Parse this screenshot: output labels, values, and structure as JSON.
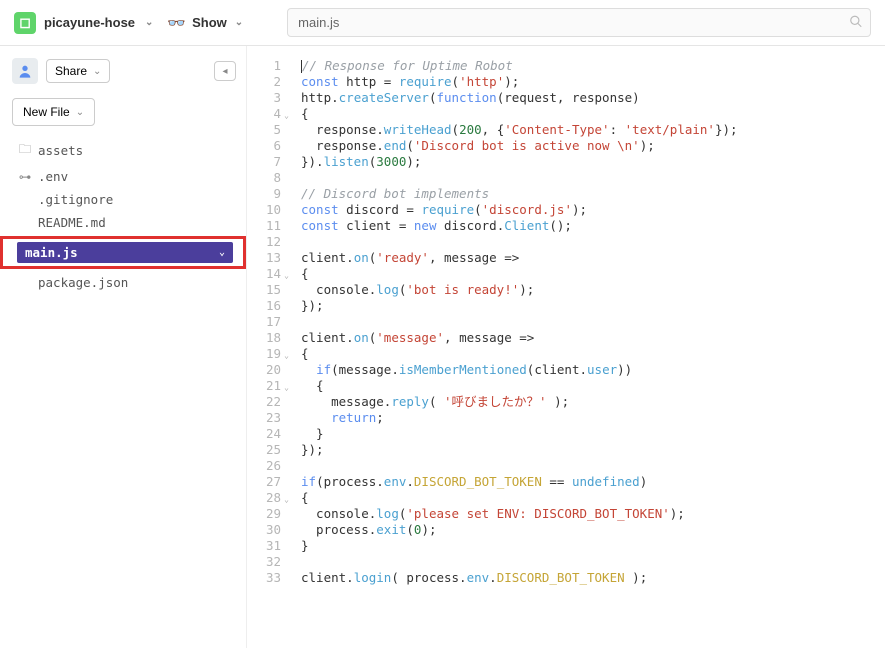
{
  "header": {
    "project_name": "picayune-hose",
    "show_label": "Show",
    "search_value": "main.js"
  },
  "sidebar": {
    "share_label": "Share",
    "newfile_label": "New File",
    "files": [
      {
        "icon": "folder",
        "name": "assets"
      },
      {
        "icon": "key",
        "name": ".env"
      },
      {
        "icon": "",
        "name": ".gitignore"
      },
      {
        "icon": "",
        "name": "README.md"
      },
      {
        "icon": "",
        "name": "main.js",
        "active": true
      },
      {
        "icon": "",
        "name": "package.json"
      }
    ]
  },
  "colors": {
    "accent": "#5fd46a",
    "highlight_bg": "#4b3e9c",
    "highlight_border": "#e0312f"
  },
  "code": {
    "lines": [
      {
        "n": 1,
        "tokens": [
          {
            "t": "// Response for Uptime Robot",
            "c": "c-com",
            "cursor": true
          }
        ]
      },
      {
        "n": 2,
        "tokens": [
          {
            "t": "const",
            "c": "c-kw"
          },
          {
            "t": " http = "
          },
          {
            "t": "require",
            "c": "c-fn"
          },
          {
            "t": "("
          },
          {
            "t": "'http'",
            "c": "c-str"
          },
          {
            "t": ");"
          }
        ]
      },
      {
        "n": 3,
        "tokens": [
          {
            "t": "http."
          },
          {
            "t": "createServer",
            "c": "c-prop"
          },
          {
            "t": "("
          },
          {
            "t": "function",
            "c": "c-kw"
          },
          {
            "t": "(request, response)"
          }
        ]
      },
      {
        "n": 4,
        "fold": true,
        "tokens": [
          {
            "t": "{"
          }
        ]
      },
      {
        "n": 5,
        "tokens": [
          {
            "t": "  response."
          },
          {
            "t": "writeHead",
            "c": "c-prop"
          },
          {
            "t": "("
          },
          {
            "t": "200",
            "c": "c-num"
          },
          {
            "t": ", {"
          },
          {
            "t": "'Content-Type'",
            "c": "c-str"
          },
          {
            "t": ": "
          },
          {
            "t": "'text/plain'",
            "c": "c-str"
          },
          {
            "t": "});"
          }
        ]
      },
      {
        "n": 6,
        "tokens": [
          {
            "t": "  response."
          },
          {
            "t": "end",
            "c": "c-prop"
          },
          {
            "t": "("
          },
          {
            "t": "'Discord bot is active now \\n'",
            "c": "c-str"
          },
          {
            "t": ");"
          }
        ]
      },
      {
        "n": 7,
        "tokens": [
          {
            "t": "})."
          },
          {
            "t": "listen",
            "c": "c-prop"
          },
          {
            "t": "("
          },
          {
            "t": "3000",
            "c": "c-num"
          },
          {
            "t": ");"
          }
        ]
      },
      {
        "n": 8,
        "tokens": []
      },
      {
        "n": 9,
        "tokens": [
          {
            "t": "// Discord bot implements",
            "c": "c-com"
          }
        ]
      },
      {
        "n": 10,
        "tokens": [
          {
            "t": "const",
            "c": "c-kw"
          },
          {
            "t": " discord = "
          },
          {
            "t": "require",
            "c": "c-fn"
          },
          {
            "t": "("
          },
          {
            "t": "'discord.js'",
            "c": "c-str"
          },
          {
            "t": ");"
          }
        ]
      },
      {
        "n": 11,
        "tokens": [
          {
            "t": "const",
            "c": "c-kw"
          },
          {
            "t": " client = "
          },
          {
            "t": "new",
            "c": "c-kw"
          },
          {
            "t": " discord."
          },
          {
            "t": "Client",
            "c": "c-fn"
          },
          {
            "t": "();"
          }
        ]
      },
      {
        "n": 12,
        "tokens": []
      },
      {
        "n": 13,
        "tokens": [
          {
            "t": "client."
          },
          {
            "t": "on",
            "c": "c-prop"
          },
          {
            "t": "("
          },
          {
            "t": "'ready'",
            "c": "c-str"
          },
          {
            "t": ", message =>"
          }
        ]
      },
      {
        "n": 14,
        "fold": true,
        "tokens": [
          {
            "t": "{"
          }
        ]
      },
      {
        "n": 15,
        "tokens": [
          {
            "t": "  console."
          },
          {
            "t": "log",
            "c": "c-prop"
          },
          {
            "t": "("
          },
          {
            "t": "'bot is ready!'",
            "c": "c-str"
          },
          {
            "t": ");"
          }
        ]
      },
      {
        "n": 16,
        "tokens": [
          {
            "t": "});"
          }
        ]
      },
      {
        "n": 17,
        "tokens": []
      },
      {
        "n": 18,
        "tokens": [
          {
            "t": "client."
          },
          {
            "t": "on",
            "c": "c-prop"
          },
          {
            "t": "("
          },
          {
            "t": "'message'",
            "c": "c-str"
          },
          {
            "t": ", message =>"
          }
        ]
      },
      {
        "n": 19,
        "fold": true,
        "tokens": [
          {
            "t": "{"
          }
        ]
      },
      {
        "n": 20,
        "tokens": [
          {
            "t": "  "
          },
          {
            "t": "if",
            "c": "c-kw"
          },
          {
            "t": "(message."
          },
          {
            "t": "isMemberMentioned",
            "c": "c-prop"
          },
          {
            "t": "(client."
          },
          {
            "t": "user",
            "c": "c-prop"
          },
          {
            "t": "))"
          }
        ]
      },
      {
        "n": 21,
        "fold": true,
        "tokens": [
          {
            "t": "  {"
          }
        ]
      },
      {
        "n": 22,
        "tokens": [
          {
            "t": "    message."
          },
          {
            "t": "reply",
            "c": "c-prop"
          },
          {
            "t": "( "
          },
          {
            "t": "'呼びましたか？'",
            "c": "c-str"
          },
          {
            "t": " );"
          }
        ]
      },
      {
        "n": 23,
        "tokens": [
          {
            "t": "    "
          },
          {
            "t": "return",
            "c": "c-kw"
          },
          {
            "t": ";"
          }
        ]
      },
      {
        "n": 24,
        "tokens": [
          {
            "t": "  }"
          }
        ]
      },
      {
        "n": 25,
        "tokens": [
          {
            "t": "});"
          }
        ]
      },
      {
        "n": 26,
        "tokens": []
      },
      {
        "n": 27,
        "tokens": [
          {
            "t": "if",
            "c": "c-kw"
          },
          {
            "t": "(process."
          },
          {
            "t": "env",
            "c": "c-prop"
          },
          {
            "t": "."
          },
          {
            "t": "DISCORD_BOT_TOKEN",
            "c": "c-const"
          },
          {
            "t": " == "
          },
          {
            "t": "undefined",
            "c": "c-fn"
          },
          {
            "t": ")"
          }
        ]
      },
      {
        "n": 28,
        "fold": true,
        "tokens": [
          {
            "t": "{"
          }
        ]
      },
      {
        "n": 29,
        "tokens": [
          {
            "t": "  console."
          },
          {
            "t": "log",
            "c": "c-prop"
          },
          {
            "t": "("
          },
          {
            "t": "'please set ENV: DISCORD_BOT_TOKEN'",
            "c": "c-str"
          },
          {
            "t": ");"
          }
        ]
      },
      {
        "n": 30,
        "tokens": [
          {
            "t": "  process."
          },
          {
            "t": "exit",
            "c": "c-prop"
          },
          {
            "t": "("
          },
          {
            "t": "0",
            "c": "c-num"
          },
          {
            "t": ");"
          }
        ]
      },
      {
        "n": 31,
        "tokens": [
          {
            "t": "}"
          }
        ]
      },
      {
        "n": 32,
        "tokens": []
      },
      {
        "n": 33,
        "tokens": [
          {
            "t": "client."
          },
          {
            "t": "login",
            "c": "c-prop"
          },
          {
            "t": "( process."
          },
          {
            "t": "env",
            "c": "c-prop"
          },
          {
            "t": "."
          },
          {
            "t": "DISCORD_BOT_TOKEN",
            "c": "c-const"
          },
          {
            "t": " );"
          }
        ]
      }
    ]
  }
}
